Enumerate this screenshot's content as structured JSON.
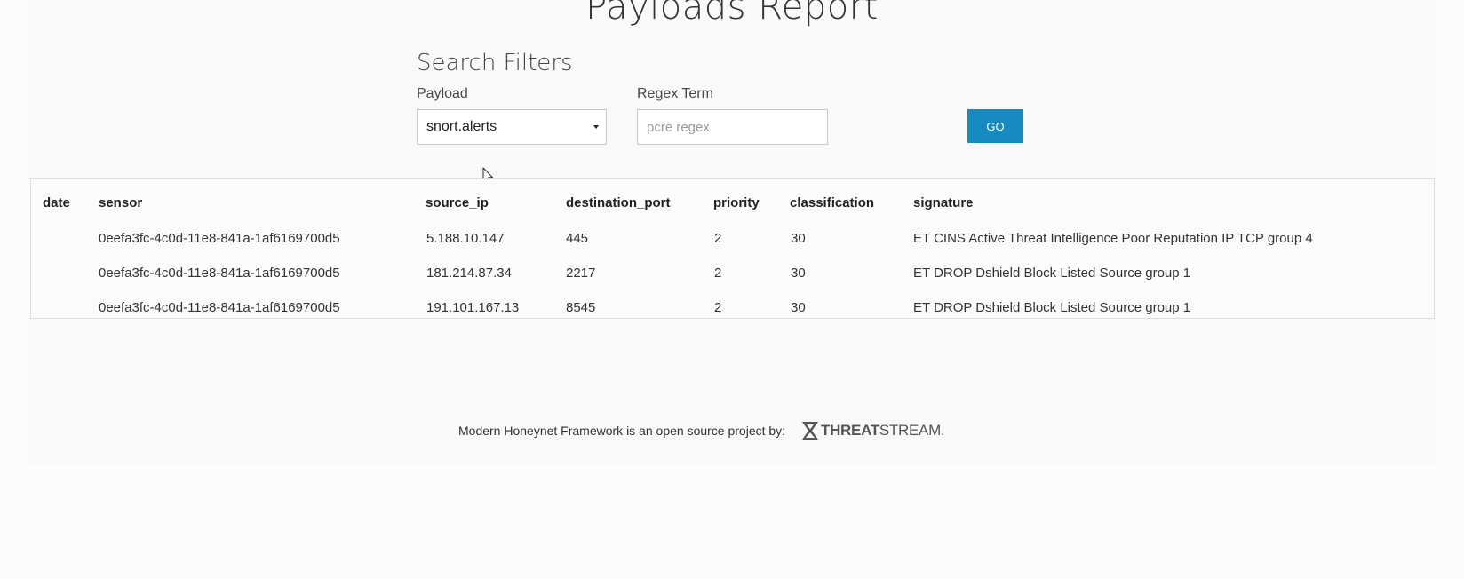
{
  "page": {
    "title": "Payloads Report"
  },
  "filters": {
    "title": "Search Filters",
    "payload_label": "Payload",
    "payload_value": "snort.alerts",
    "regex_label": "Regex Term",
    "regex_placeholder": "pcre regex",
    "regex_value": "",
    "go_label": "GO"
  },
  "table": {
    "columns": [
      "date",
      "sensor",
      "source_ip",
      "destination_port",
      "priority",
      "classification",
      "signature"
    ],
    "rows": [
      {
        "date": "",
        "sensor": "0eefa3fc-4c0d-11e8-841a-1af6169700d5",
        "source_ip": "5.188.10.147",
        "destination_port": "445",
        "priority": "2",
        "classification": "30",
        "signature": "ET CINS Active Threat Intelligence Poor Reputation IP TCP group 4"
      },
      {
        "date": "",
        "sensor": "0eefa3fc-4c0d-11e8-841a-1af6169700d5",
        "source_ip": "181.214.87.34",
        "destination_port": "2217",
        "priority": "2",
        "classification": "30",
        "signature": "ET DROP Dshield Block Listed Source group 1"
      },
      {
        "date": "",
        "sensor": "0eefa3fc-4c0d-11e8-841a-1af6169700d5",
        "source_ip": "191.101.167.13",
        "destination_port": "8545",
        "priority": "2",
        "classification": "30",
        "signature": "ET DROP Dshield Block Listed Source group 1"
      }
    ]
  },
  "footer": {
    "text": "Modern Honeynet Framework is an open source project by:",
    "logo_bold": "THREAT",
    "logo_light": "STREAM."
  },
  "icons": {
    "cursor": "mouse-pointer-icon",
    "caret": "caret-down-icon",
    "logo": "threatstream-hourglass-icon"
  },
  "colors": {
    "accent": "#178ac0",
    "background": "#fcfcfc"
  }
}
